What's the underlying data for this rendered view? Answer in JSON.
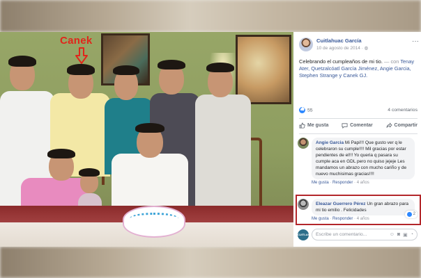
{
  "annotation": {
    "label": "Canek"
  },
  "post": {
    "author": "Cuitlahuac García",
    "date": "10 de agosto de 2014",
    "caption_main": "Celebrando el cumpleaños de mi tio.",
    "caption_sep": " — con ",
    "caption_tags": "Tenay Ater, Quetzalcóatl García Jiménez, Angie Garcia, Stephen Strange y Canek GJ.",
    "likes_count": "55",
    "comments_count": "4 comentarios",
    "actions": {
      "like": "Me gusta",
      "comment": "Comentar",
      "share": "Compartir"
    }
  },
  "comments": [
    {
      "name": "Angie Garcia",
      "text": " Mi Papi!!! Que gusto ver q le celebraron su cumple!!!! Mil gracias por estar pendientes de el!!! Yo queria q pasara su cumple aca en GDL pero no quiso jejeje Les mandamos un abrazo con mucho cariño y de nuevo muchisimas gracias!!!!",
      "like": "Me gusta",
      "reply": "Responder",
      "time": "4 años",
      "reactions": ""
    },
    {
      "name": "Eleazar Guerrero Pérez",
      "text": " Un gran abrazo para mi tio emilio . Felicidades",
      "like": "Me gusta",
      "reply": "Responder",
      "time": "4 años",
      "reactions": "2"
    }
  ],
  "write": {
    "placeholder": "Escribe un comentario...",
    "avatar_text": "CUITLAHUAC"
  },
  "colors": {
    "link": "#385898",
    "like_blue": "#2d88ff",
    "highlight": "#b3262a",
    "annotation": "#e0261b"
  }
}
